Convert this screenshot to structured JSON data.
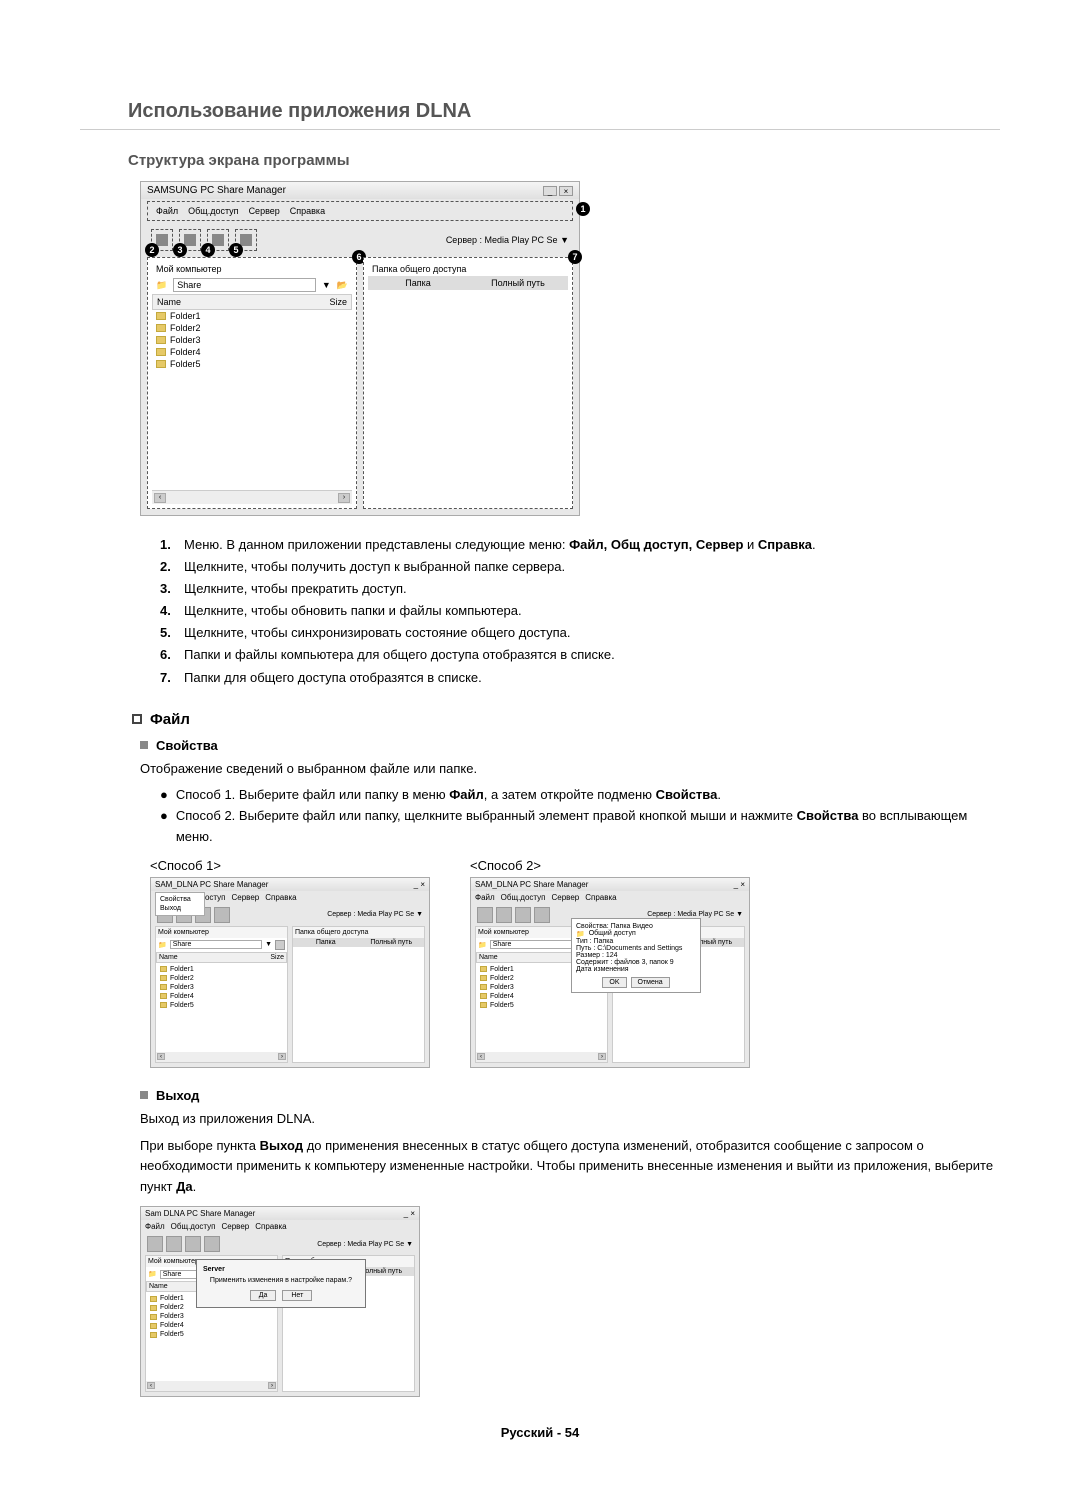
{
  "heading": "Использование приложения DLNA",
  "subheading1": "Структура экрана программы",
  "app": {
    "title": "SAMSUNG PC Share Manager",
    "menus": [
      "Файл",
      "Общ.доступ",
      "Сервер",
      "Справка"
    ],
    "server_label": "Сервер :",
    "server_value": "Media Play PC Se",
    "pane_left_title": "Мой компьютер",
    "pane_right_title": "Папка общего доступа",
    "share_label": "Share",
    "col_name": "Name",
    "col_size": "Size",
    "folders": [
      "Folder1",
      "Folder2",
      "Folder3",
      "Folder4",
      "Folder5"
    ],
    "right_col1": "Папка",
    "right_col2": "Полный путь"
  },
  "callouts": {
    "c1": "1",
    "c2": "2",
    "c3": "3",
    "c4": "4",
    "c5": "5",
    "c6": "6",
    "c7": "7"
  },
  "numbered": [
    {
      "n": "1.",
      "prefix": "Меню. В данном приложении представлены следующие меню: ",
      "bold": "Файл, Общ доступ, Сервер",
      "mid": " и ",
      "bold2": "Справка",
      "suffix": "."
    },
    {
      "n": "2.",
      "text": "Щелкните, чтобы получить доступ к выбранной папке сервера."
    },
    {
      "n": "3.",
      "text": "Щелкните, чтобы прекратить доступ."
    },
    {
      "n": "4.",
      "text": "Щелкните, чтобы обновить папки и файлы компьютера."
    },
    {
      "n": "5.",
      "text": "Щелкните, чтобы синхронизировать состояние общего доступа."
    },
    {
      "n": "6.",
      "text": "Папки и файлы компьютера для общего доступа отобразятся в списке."
    },
    {
      "n": "7.",
      "text": "Папки для общего доступа отобразятся в списке."
    }
  ],
  "section_file": "Файл",
  "section_props": "Свойства",
  "props_body": "Отображение сведений о выбранном файле или папке.",
  "method1_text_pre": "Способ 1. Выберите файл или папку в меню ",
  "method1_bold1": "Файл",
  "method1_mid": ", а затем откройте подменю ",
  "method1_bold2": "Свойства",
  "method1_end": ".",
  "method2_text_pre": "Способ 2. Выберите файл или папку, щелкните выбранный элемент правой кнопкой мыши и нажмите ",
  "method2_bold": "Свойства",
  "method2_end": " во всплывающем меню.",
  "method1_label": "<Способ 1>",
  "method2_label": "<Способ 2>",
  "small_app": {
    "title": "SAM_DLNA PC Share Manager",
    "menu_items": [
      "Файл",
      "Общ.доступ",
      "Сервер",
      "Справка"
    ],
    "file_menu": [
      "Свойства",
      "Выход"
    ],
    "server_label": "Сервер :",
    "server_value": "Media Play PC Se",
    "pane_left_title": "Мой компьютер",
    "pane_right_title": "Папка общего доступа",
    "share_label": "Share",
    "col_name": "Name",
    "col_size": "Size",
    "folders": [
      "Folder1",
      "Folder2",
      "Folder3",
      "Folder4",
      "Folder5"
    ],
    "right_col1": "Папка",
    "right_col2": "Полный путь"
  },
  "props_dialog": {
    "title": "Свойства: Папка Видео",
    "line_catalog": "Общий доступ",
    "line_type_label": "Тип : Папка",
    "line_path": "Путь : C:\\Documents and Settings",
    "line_size": "Размер : 124",
    "line_contains": "Содержит : файлов 3, папок 9",
    "line_date": "Дата изменения",
    "ok": "OK",
    "cancel": "Отмена"
  },
  "section_exit": "Выход",
  "exit_body1": "Выход из приложения DLNA.",
  "exit_body2_pre": "При выборе пункта ",
  "exit_body2_bold1": "Выход",
  "exit_body2_mid": " до применения внесенных в статус общего доступа изменений, отобразится сообщение с запросом о необходимости применить к компьютеру измененные настройки. Чтобы применить внесенные изменения и выйти из приложения, выберите пункт ",
  "exit_body2_bold2": "Да",
  "exit_body2_end": ".",
  "confirm": {
    "title": "Server",
    "text": "Применить изменения в настройке парам.?",
    "yes": "Да",
    "no": "Нет"
  },
  "footer": "Русский - 54"
}
